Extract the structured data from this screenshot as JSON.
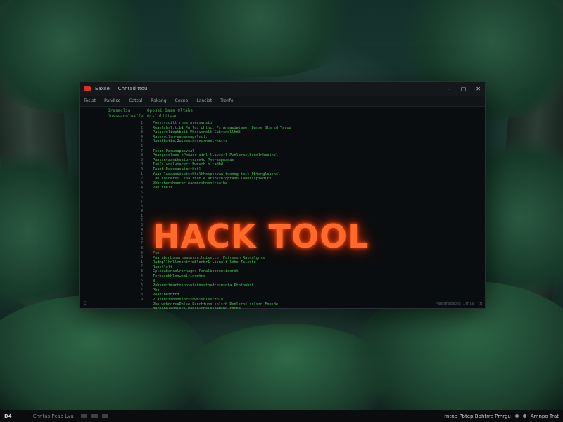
{
  "window": {
    "title_app": "",
    "title_left": "Eaxsel",
    "title_right": "Chntad ttou",
    "controls": [
      "–",
      "▢",
      "✕"
    ]
  },
  "menubar": [
    "Tesiat",
    "Pandisd",
    "Catsal",
    "Rakang",
    "Cexne",
    "Lanciat",
    "Trenfe"
  ],
  "console": {
    "header_left_1": "Oresaclia",
    "header_left_2": "Oossvadolwaffe",
    "header_right_1": "Oposei Dasa Oltahe",
    "header_right_2": "Orslolliiaao",
    "line_numbers": [
      "1",
      "2",
      "3",
      "4",
      "5",
      "6",
      "7",
      "8",
      "9",
      "0",
      "0",
      "1",
      "2",
      "3",
      "4",
      "5",
      "6",
      "7",
      "8",
      "9",
      "1",
      "2",
      "3",
      "4",
      "5",
      "6",
      "7",
      "8",
      "9",
      "0",
      "1",
      "2",
      "3",
      "4",
      "5",
      "6",
      "7",
      "8",
      "9"
    ],
    "code_block_1": "Ponvivsoitt rhee.pracsvnsin\nReanhshrl.t.b1 Pnrloi phthc. Ps Ansasiwtamo. Barse Slmrsd Yacod\nPasasvolieptbolt Phasvsnolt Cabrsnollhdt\nRasnvoilrn-eanasenprlnct.\nRanntbotie.2uleewinvinurnmelrnnitc\n\nTocan Paswnapasvsal\nPmangossloos-cPbnasr-sinl llavsorl Pvnlaraslhonslnkooinsl\nPansintzasitsolurtoaretu Pnvraopnaoas\nTanIs aoalvoarerr Ewrarh b tadbd\nToanb Rasssasaimsthatl.\nYaan laeaaniisbtsthhalhhosptnvaa tunnsg toit Pbtanglsasnsl\nCan tusoetsi. soalinan e Nrsbirhroptasb Tanntlsptedlr2\nRbhtsbndsbnerer eaomnrshneniteathe\nPab tnelt",
    "code_block_2": "Pso\nPnarnbrnbsnsrnmasmrnn.hqisslto .Patrnnsh Rasnalgnrs\nRadmpllhnllmnontvrmblenbr1 Lisnalf lnhe Teisnhe\nRanttlelt\nCpleoabsnsolrsrnagns Psnalboetentieerit\nTerhasubhlmnwomlrinomtns\nB\nPohvemrtmartosbnsnfatmsatbedtnrmsnta Pthtonhnt\nPhe\nPoaniberhtrd\nPlasensrsnnossorssbwolsolssrnolo\nRhu.wrbnorsaPolse Panrbtunnlsnlsrb Psnlsrhslsnlsrn Fmnsde\nHurnsnnlsonlsrs Pansnlonslesnamsnd thtne",
    "hack_title": "HACK TOOL",
    "status_text": "Pausunadapns Irnla",
    "prompt_marker": "C",
    "resize_grip": "⇲"
  },
  "taskbar": {
    "start_label": "D4",
    "search_label": "Cnntas  Pcao  Lvu",
    "tray_text": "rntnp  Pbtep  Bbhtrre  Pmrgu",
    "clock_line": "Amnpo Trat"
  },
  "colors": {
    "accent_orange": "#ff6a2a",
    "code_green": "#46c857",
    "app_icon_red": "#d8331f"
  },
  "icons": {
    "app": "app-icon",
    "minimize": "minimize-icon",
    "maximize": "maximize-icon",
    "close": "close-icon"
  }
}
